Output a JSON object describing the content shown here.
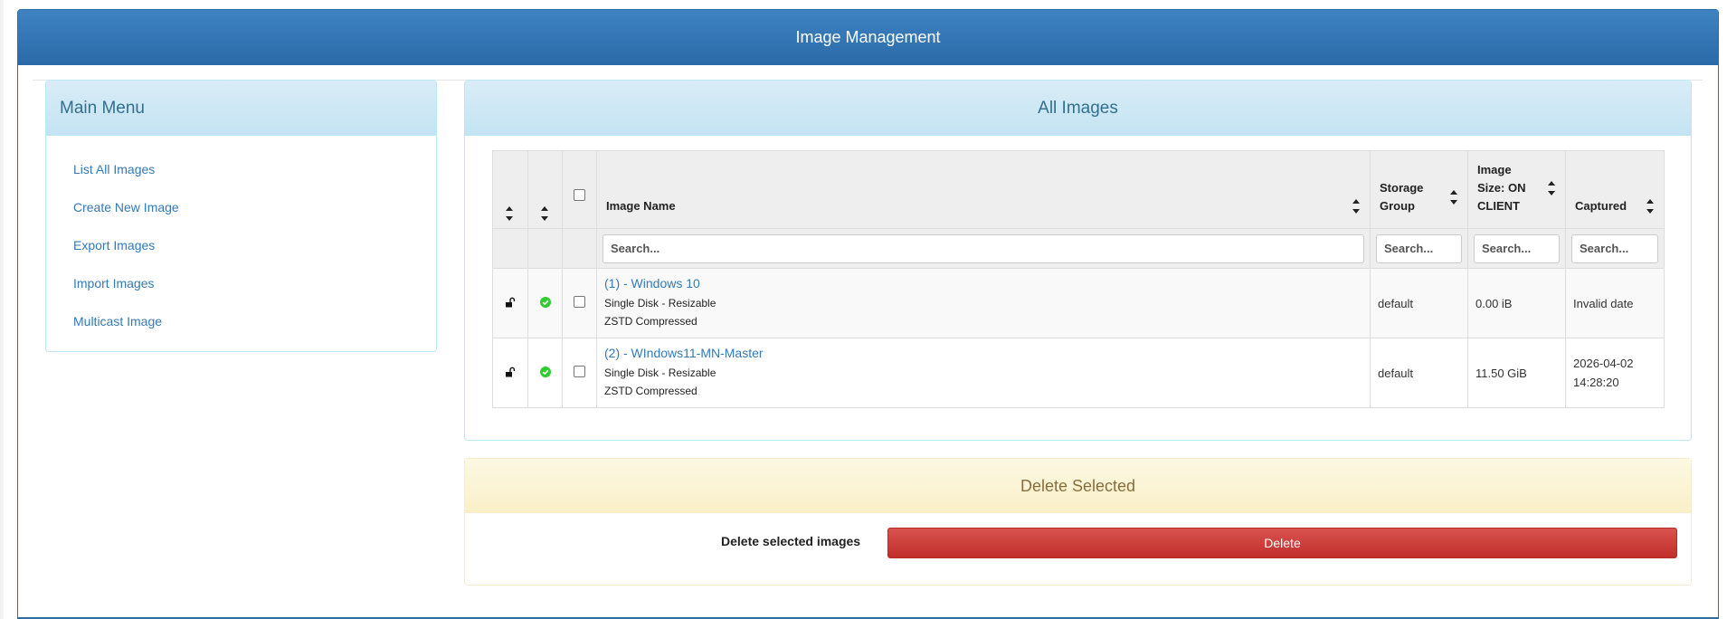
{
  "header": {
    "title": "Image Management"
  },
  "menu": {
    "title": "Main Menu",
    "items": [
      {
        "label": "List All Images"
      },
      {
        "label": "Create New Image"
      },
      {
        "label": "Export Images"
      },
      {
        "label": "Import Images"
      },
      {
        "label": "Multicast Image"
      }
    ]
  },
  "images": {
    "title": "All Images",
    "columns": {
      "name": "Image Name",
      "storage_line1": "Storage",
      "storage_line2": "Group",
      "size_line1": "Image",
      "size_line2": "Size: ON",
      "size_line3": "CLIENT",
      "captured": "Captured"
    },
    "search_placeholder": "Search...",
    "rows": [
      {
        "name": "(1) - Windows 10",
        "disk": "Single Disk - Resizable",
        "compression": "ZSTD Compressed",
        "storage": "default",
        "size": "0.00 iB",
        "captured_line1": "Invalid date",
        "captured_line2": ""
      },
      {
        "name": "(2) - WIndows11-MN-Master",
        "disk": "Single Disk - Resizable",
        "compression": "ZSTD Compressed",
        "storage": "default",
        "size": "11.50 GiB",
        "captured_line1": "2026-04-02",
        "captured_line2": "14:28:20"
      }
    ]
  },
  "delete": {
    "title": "Delete Selected",
    "label": "Delete selected images",
    "button": "Delete"
  },
  "colors": {
    "header": "#2e6da4",
    "info": "#31708f",
    "link": "#337ab7",
    "success_icon": "#2ecc2e",
    "danger": "#c9302c",
    "warning_text": "#8a6d3b"
  },
  "icons": [
    "unlock-icon",
    "check-circle-icon",
    "sort-icon"
  ]
}
